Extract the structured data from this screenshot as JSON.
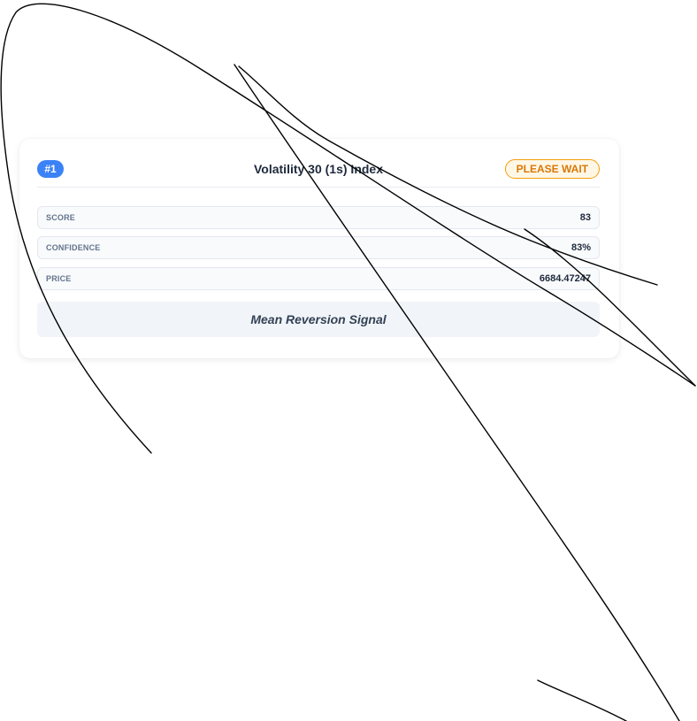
{
  "card": {
    "rank": "#1",
    "symbol": "Volatility 30 (1s) Index",
    "status": "PLEASE WAIT",
    "metrics": [
      {
        "label": "SCORE",
        "value": "83"
      },
      {
        "label": "CONFIDENCE",
        "value": "83%"
      },
      {
        "label": "PRICE",
        "value": "6684.47247"
      }
    ],
    "signal": "Mean Reversion Signal"
  },
  "colors": {
    "rank_badge": "#3b82f6",
    "status_border": "#f59e0b",
    "status_text": "#d97706",
    "signal_bg": "#f1f5f9"
  }
}
